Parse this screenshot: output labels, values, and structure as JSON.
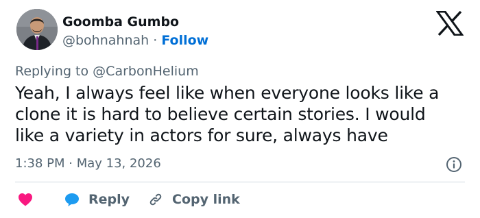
{
  "author": {
    "name": "Goomba Gumbo",
    "handle": "@bohnahnah",
    "separator": "·",
    "follow_label": "Follow"
  },
  "reply_context": {
    "prefix": "Replying to",
    "handle": "@CarbonHelium"
  },
  "tweet": {
    "lines": [
      "Yeah, I always feel like when everyone looks like a",
      "clone it is hard to believe certain stories. I would",
      "like a variety in actors for sure, always have"
    ]
  },
  "meta": {
    "timestamp": "1:38 PM · May 13, 2026"
  },
  "actions": {
    "reply_label": "Reply",
    "copy_label": "Copy link"
  },
  "icons": {
    "logo": "x-logo-icon",
    "info": "info-icon",
    "like": "heart-icon",
    "reply": "speech-bubble-icon",
    "copy": "link-icon"
  },
  "colors": {
    "text": "#0f1419",
    "secondary": "#536471",
    "link": "#006fd6",
    "heart": "#f91880",
    "reply_bubble": "#1d9bf0",
    "divider": "#cfd9de"
  }
}
